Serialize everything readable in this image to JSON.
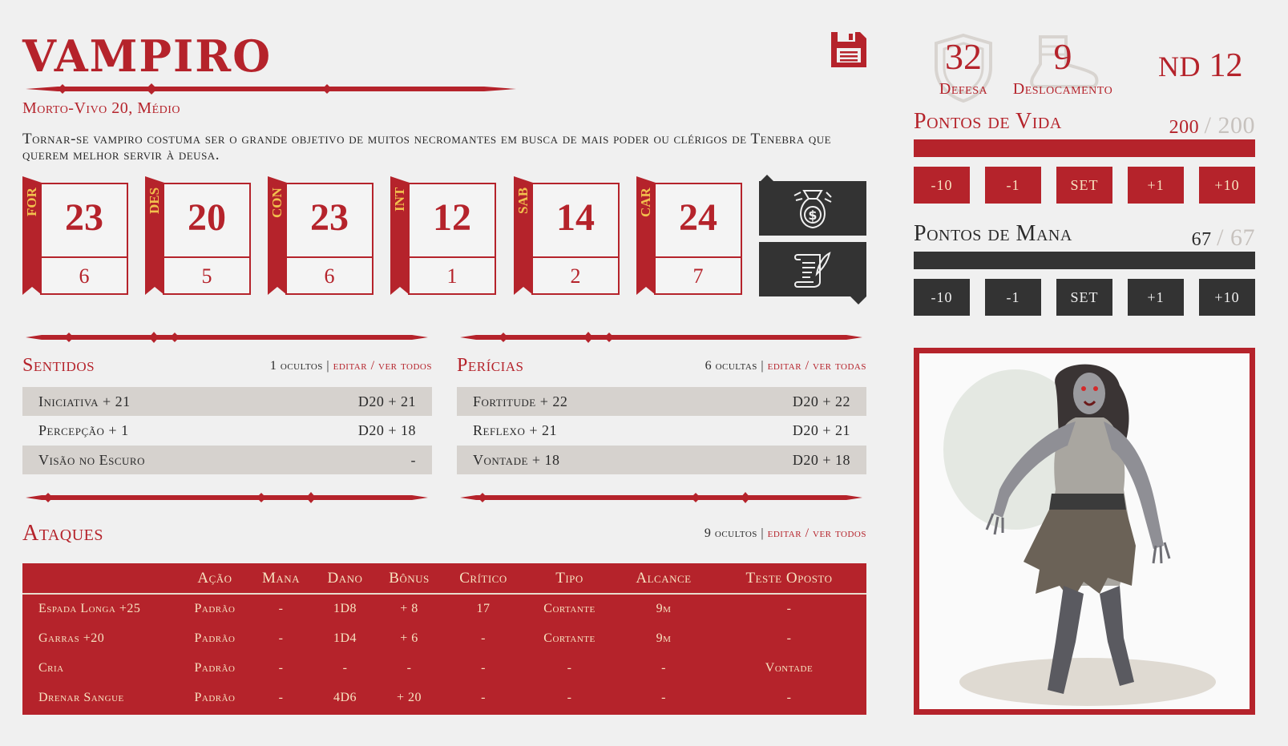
{
  "monster": {
    "name": "VAMPIRO",
    "subtitle": "Morto-Vivo  20,  Médio",
    "description": "Tornar-se vampiro costuma ser o grande objetivo de muitos necromantes em busca de mais poder ou clérigos de Tenebra que querem melhor servir à deusa."
  },
  "attributes": [
    {
      "abbr": "FOR",
      "value": "23",
      "mod": "6"
    },
    {
      "abbr": "DES",
      "value": "20",
      "mod": "5"
    },
    {
      "abbr": "CON",
      "value": "23",
      "mod": "6"
    },
    {
      "abbr": "INT",
      "value": "12",
      "mod": "1"
    },
    {
      "abbr": "SAB",
      "value": "14",
      "mod": "2"
    },
    {
      "abbr": "CAR",
      "value": "24",
      "mod": "7"
    }
  ],
  "senses": {
    "title": "Sentidos",
    "hidden": "1 ocultos",
    "link": "editar / ver todos",
    "rows": [
      {
        "label": "Iniciativa + 21",
        "roll": "D20 + 21"
      },
      {
        "label": "Percepção + 1",
        "roll": "D20 + 18"
      },
      {
        "label": "Visão no Escuro",
        "roll": "-"
      }
    ]
  },
  "skills": {
    "title": "Perícias",
    "hidden": "6 ocultas",
    "link": "editar / ver todas",
    "rows": [
      {
        "label": "Fortitude + 22",
        "roll": "D20 + 22"
      },
      {
        "label": "Reflexo + 21",
        "roll": "D20 + 21"
      },
      {
        "label": "Vontade + 18",
        "roll": "D20 + 18"
      }
    ]
  },
  "attacks": {
    "title": "Ataques",
    "hidden": "9 ocultos",
    "link": "editar / ver todos",
    "headers": [
      "",
      "Ação",
      "Mana",
      "Dano",
      "Bônus",
      "Crítico",
      "Tipo",
      "Alcance",
      "Teste Oposto"
    ],
    "rows": [
      [
        "Espada Longa +25",
        "Padrão",
        "-",
        "1D8",
        "+ 8",
        "17",
        "Cortante",
        "9m",
        "-"
      ],
      [
        "Garras +20",
        "Padrão",
        "-",
        "1D4",
        "+ 6",
        "-",
        "Cortante",
        "9m",
        "-"
      ],
      [
        "Cria",
        "Padrão",
        "-",
        "-",
        "-",
        "-",
        "-",
        "-",
        "Vontade"
      ],
      [
        "Drenar Sangue",
        "Padrão",
        "-",
        "4D6",
        "+ 20",
        "-",
        "-",
        "-",
        "-"
      ]
    ]
  },
  "stats": {
    "defense_value": "32",
    "defense_label": "Defesa",
    "speed_value": "9",
    "speed_label": "Deslocamento",
    "nd_label": "ND",
    "nd_value": "12"
  },
  "hp": {
    "title": "Pontos de Vida",
    "current": "200",
    "max": "/ 200",
    "fill_fraction": 1.0,
    "buttons": [
      "-10",
      "-1",
      "SET",
      "+1",
      "+10"
    ],
    "color": "#b5232b"
  },
  "mp": {
    "title": "Pontos de Mana",
    "current": "67",
    "max": "/ 67",
    "fill_fraction": 1.0,
    "buttons": [
      "-10",
      "-1",
      "SET",
      "+1",
      "+10"
    ],
    "color": "#333333"
  },
  "icons": {
    "save": "floppy-disk-icon",
    "money": "money-bag-icon",
    "scroll": "scroll-quill-icon",
    "defense": "shield-icon",
    "speed": "boot-icon"
  },
  "colors": {
    "accent": "#b5232b",
    "dark": "#333333",
    "background": "#f0f0f0",
    "row_shade": "#d6d2ce",
    "flag_text": "#f2c14e"
  }
}
